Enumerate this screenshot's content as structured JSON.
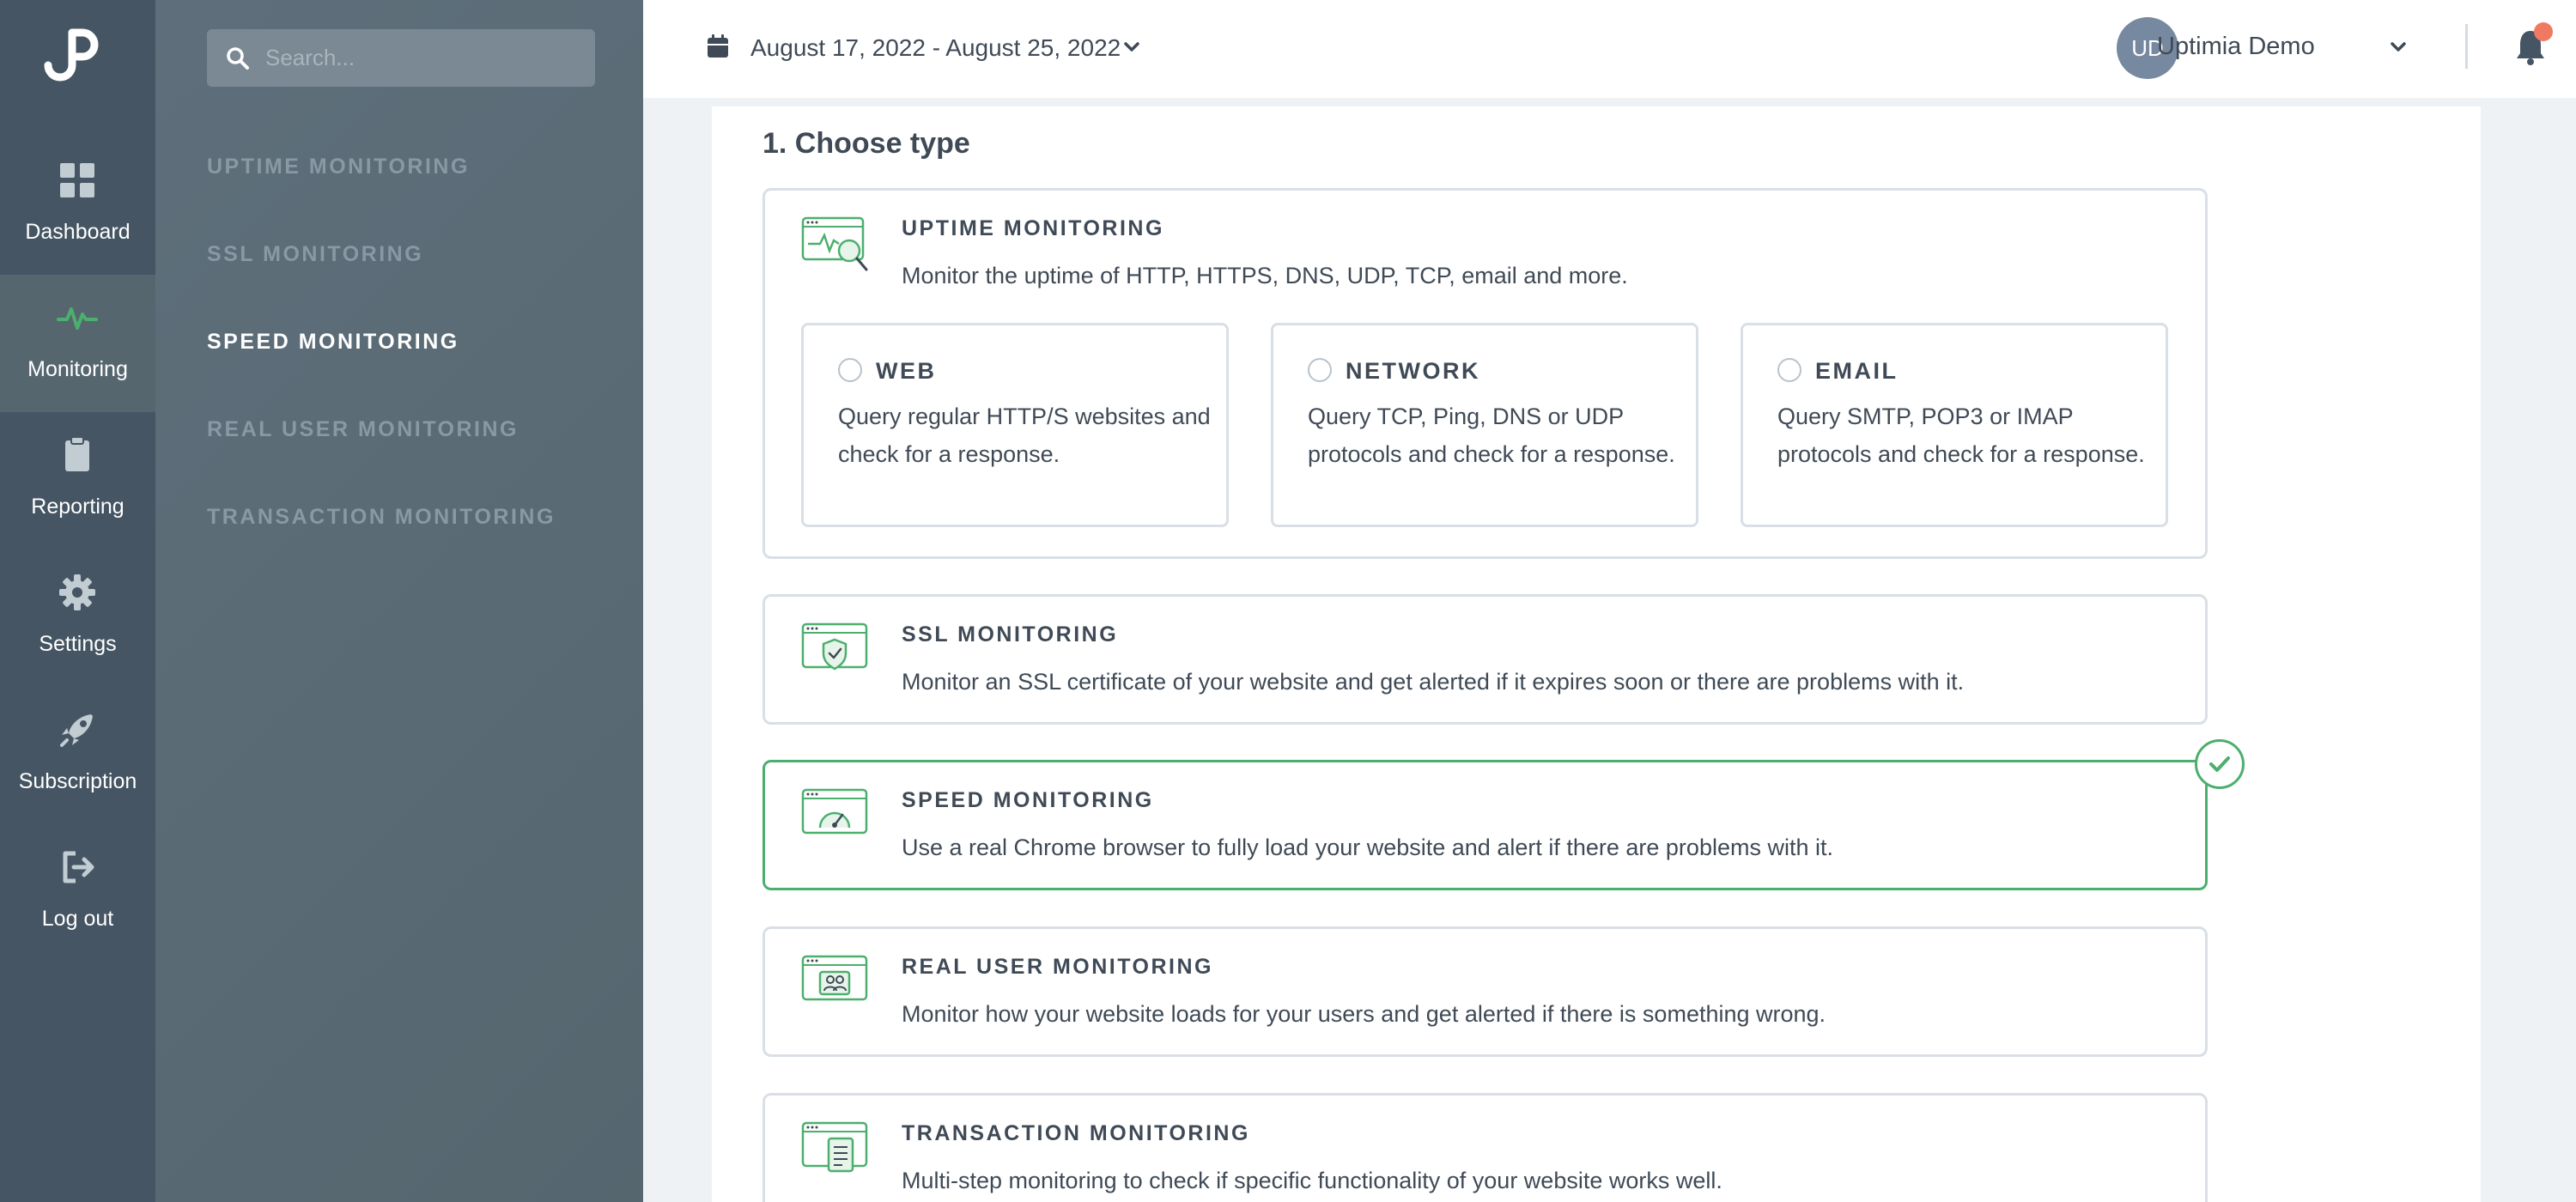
{
  "rail": {
    "items": [
      {
        "label": "Dashboard",
        "icon": "grid-icon"
      },
      {
        "label": "Monitoring",
        "icon": "pulse-icon",
        "active": true
      },
      {
        "label": "Reporting",
        "icon": "clipboard-icon"
      },
      {
        "label": "Settings",
        "icon": "gear-icon"
      },
      {
        "label": "Subscription",
        "icon": "rocket-icon"
      },
      {
        "label": "Log out",
        "icon": "logout-icon"
      }
    ]
  },
  "submenu": {
    "search_placeholder": "Search...",
    "items": [
      {
        "label": "UPTIME MONITORING"
      },
      {
        "label": "SSL MONITORING"
      },
      {
        "label": "SPEED MONITORING",
        "active": true
      },
      {
        "label": "REAL USER MONITORING"
      },
      {
        "label": "TRANSACTION MONITORING"
      }
    ]
  },
  "topbar": {
    "date_range": "August 17, 2022 - August 25, 2022",
    "avatar_initials": "UD",
    "user_name": "Uptimia Demo"
  },
  "main": {
    "step_title": "1. Choose type",
    "cards": [
      {
        "title": "UPTIME MONITORING",
        "description": "Monitor the uptime of HTTP, HTTPS, DNS, UDP, TCP, email and more.",
        "subtypes": [
          {
            "title": "WEB",
            "description": "Query regular HTTP/S websites and check for a response."
          },
          {
            "title": "NETWORK",
            "description": "Query TCP, Ping, DNS or UDP protocols and check for a response."
          },
          {
            "title": "EMAIL",
            "description": "Query SMTP, POP3 or IMAP protocols and check for a response."
          }
        ]
      },
      {
        "title": "SSL MONITORING",
        "description": "Monitor an SSL certificate of your website and get alerted if it expires soon or there are problems with it."
      },
      {
        "title": "SPEED MONITORING",
        "description": "Use a real Chrome browser to fully load your website and alert if there are problems with it.",
        "selected": true
      },
      {
        "title": "REAL USER MONITORING",
        "description": "Monitor how your website loads for your users and get alerted if there is something wrong."
      },
      {
        "title": "TRANSACTION MONITORING",
        "description": "Multi-step monitoring to check if specific functionality of your website works well."
      }
    ]
  },
  "colors": {
    "rail_bg": "#455563",
    "submenu_bg": "#5e6f7b",
    "accent_green": "#4caf6e",
    "notification_dot": "#ef7a61"
  }
}
